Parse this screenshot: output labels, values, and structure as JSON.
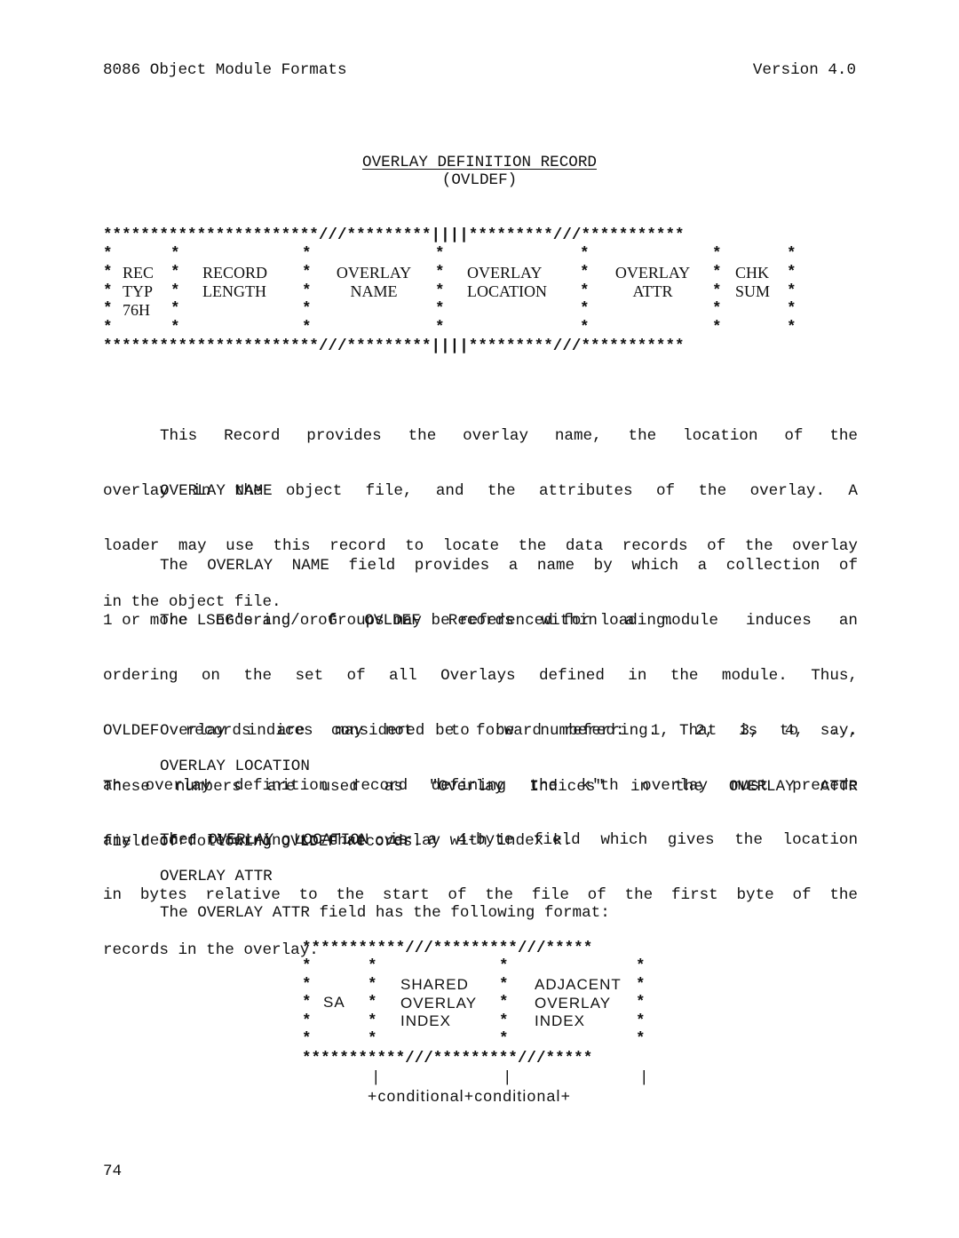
{
  "header": {
    "left": "8086 Object Module Formats",
    "right": "Version 4.0"
  },
  "title": {
    "main": "OVERLAY DEFINITION RECORD",
    "sub": "(OVLDEF)"
  },
  "record_diagram": {
    "lines": [
      "***********************///*********||||*********///***********",
      "*     *             *             *              *        *   *",
      "* REC *   RECORD    *  OVERLAY    *  OVERLAY     *  OVERLAY * CHK *",
      "* TYP *   LENGTH    *   NAME      *  LOCATION    *   ATTR   * SUM *",
      "* 76H *             *             *              *        *   *",
      "*     *             *             *              *        *   *",
      "***********************///*********||||*********///***********"
    ],
    "fields": [
      "REC TYP 76H",
      "RECORD LENGTH",
      "OVERLAY NAME",
      "OVERLAY LOCATION",
      "OVERLAY ATTR",
      "CHK SUM"
    ]
  },
  "paragraphs": {
    "intro": [
      "This  Record  provides  the  overlay  name, the location of the",
      "overlay in the object file, and the attributes of  the  overlay.  A",
      "loader may use this record to locate the data records of the overlay",
      "in the object file."
    ],
    "overlay_name_heading": "OVERLAY NAME",
    "overlay_name": [
      "The OVERLAY NAME field provides a name by which a collection of",
      "1 or more LSEG's and/or Groups may be referenced for loading."
    ],
    "ordering": [
      "The  ordering  of  OVLDEF  Records  within  a module induces an",
      "ordering on the set of all Overlays defined in  the  module.  Thus,",
      "OVLDEF  records  are  considered  to  be  numbered:  1, 2, 3, 4, ...",
      "These numbers are used as \"Overlay  Indices\"  in  the  OVERLAY  ATTR",
      "field of following OVLDEF records."
    ],
    "forward": [
      "Overlay  indices may not be forward referring.  That is to say,",
      "an overlay definition record defining the k'th overlay must  precede",
      "any record referring to that overlay with index k."
    ],
    "overlay_location_heading": "OVERLAY LOCATION",
    "overlay_location": [
      "The OVERLAY LOCATION is a 4-byte field which gives the location",
      "in bytes relative to the start of the file of the first byte of  the",
      "records in the overlay."
    ],
    "overlay_attr_heading": "OVERLAY ATTR",
    "overlay_attr": [
      "The OVERLAY ATTR field has the following format:"
    ]
  },
  "attr_diagram": {
    "lines": [
      "***********///*********///*****",
      "*      *             *            *",
      "*      *  SHARED     *  ADJACENT *",
      "* SA   *  OVERLAY    *  OVERLAY  *",
      "*      *  INDEX      *  INDEX    *",
      "*      *             *            *",
      "***********///*********///*****",
      "       |             |            |",
      "       +conditional+conditional+"
    ],
    "fields": [
      "SA",
      "SHARED OVERLAY INDEX",
      "ADJACENT OVERLAY INDEX"
    ],
    "annotation": "+conditional+conditional+"
  },
  "footer": {
    "page_number": "74"
  }
}
